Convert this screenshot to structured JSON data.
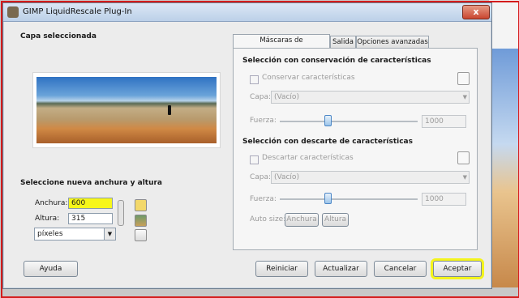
{
  "window": {
    "title": "GIMP LiquidRescale Plug-In",
    "close_label": "x"
  },
  "left": {
    "section_title": "Capa seleccionada",
    "size_title": "Seleccione nueva anchura y altura",
    "width_label": "Anchura:",
    "width_value": "600",
    "height_label": "Altura:",
    "height_value": "315",
    "unit_value": "píxeles"
  },
  "tabs": [
    {
      "label": "Máscaras de características"
    },
    {
      "label": "Salida"
    },
    {
      "label": "Opciones avanzadas"
    }
  ],
  "preserve": {
    "title": "Selección con conservación de características",
    "checkbox_label": "Conservar características",
    "layer_label": "Capa:",
    "layer_value": "(Vacío)",
    "strength_label": "Fuerza:",
    "strength_value": "1000"
  },
  "discard": {
    "title": "Selección con descarte de características",
    "checkbox_label": "Descartar características",
    "layer_label": "Capa:",
    "layer_value": "(Vacío)",
    "strength_label": "Fuerza:",
    "strength_value": "1000",
    "autosize_label": "Auto size:",
    "width_btn": "Anchura",
    "height_btn": "Altura"
  },
  "buttons": {
    "help": "Ayuda",
    "reset": "Reiniciar",
    "update": "Actualizar",
    "cancel": "Cancelar",
    "ok": "Aceptar"
  },
  "colors": {
    "highlight": "#f7f719",
    "border_red": "#d41c1c"
  }
}
